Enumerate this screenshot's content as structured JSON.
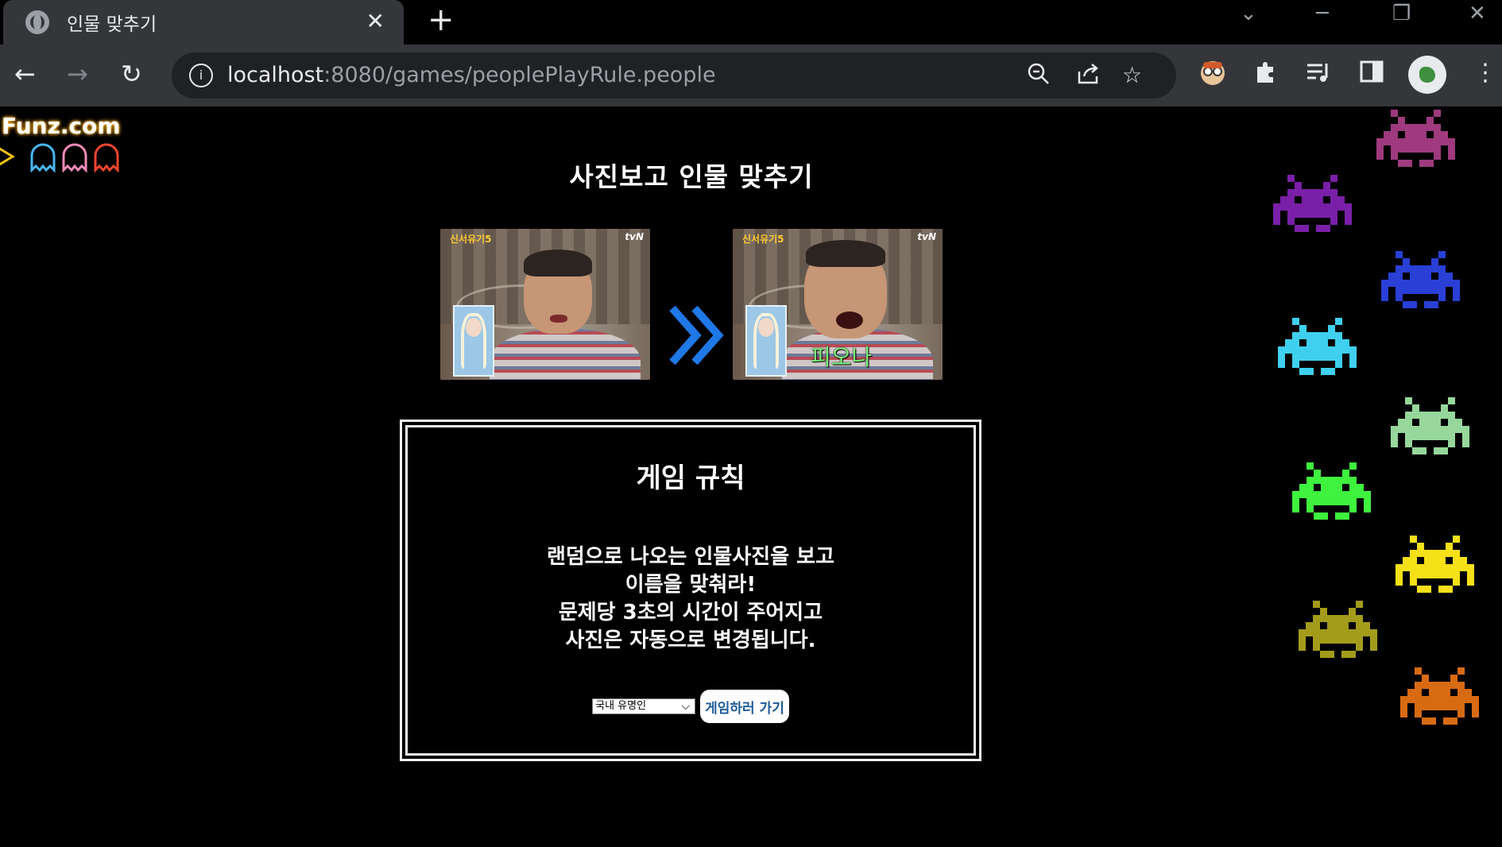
{
  "browser": {
    "tab_title": "인물 맞추기",
    "tab_close": "✕",
    "new_tab": "+",
    "url_host": "localhost",
    "url_rest": ":8080/games/peoplePlayRule.people"
  },
  "site": {
    "logo": "Funz.com"
  },
  "page": {
    "title": "사진보고 인물 맞추기",
    "photo_tl_logo": "신서유기5",
    "photo_tr_logo": "tvN",
    "answer_caption": "피오나"
  },
  "rules": {
    "title": "게임 규칙",
    "lines": [
      "랜덤으로 나오는 인물사진을 보고",
      "이름을 맞춰라!",
      "문제당 3초의 시간이 주어지고",
      "사진은 자동으로 변경됩니다."
    ],
    "category_selected": "국내 유명인",
    "start_button": "게임하러 가기"
  },
  "colors": {
    "invaders": [
      "#9e3a7d",
      "#7a1fa8",
      "#2a3fd6",
      "#3fd0ef",
      "#97d79b",
      "#3ef23e",
      "#f6e018",
      "#a39b1a",
      "#d86a12"
    ],
    "arrow": "#1e78e6"
  }
}
